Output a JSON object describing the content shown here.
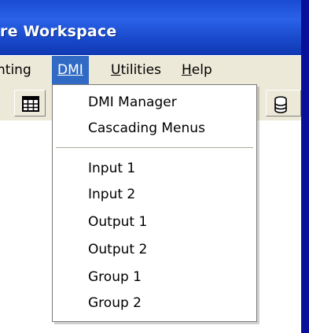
{
  "window": {
    "title": "re Workspace"
  },
  "menubar": {
    "items": [
      {
        "label": "nting"
      },
      {
        "label": "DMI"
      },
      {
        "label": "Utilities"
      },
      {
        "label": "Help"
      }
    ]
  },
  "toolbar": {
    "buttons": [
      {
        "icon": "table-grid-icon"
      },
      {
        "icon": "database-icon"
      }
    ]
  },
  "dmi_menu": {
    "items": [
      {
        "label": "DMI Manager"
      },
      {
        "label": "Cascading Menus"
      },
      {
        "label": "Input 1"
      },
      {
        "label": "Input 2"
      },
      {
        "label": "Output 1"
      },
      {
        "label": "Output 2"
      },
      {
        "label": "Group 1"
      },
      {
        "label": "Group 2"
      }
    ]
  },
  "colors": {
    "titlebar": "#2a62e8",
    "menu_highlight": "#316ac5",
    "chrome": "#ece9d8",
    "background": "#0a0f9a"
  }
}
